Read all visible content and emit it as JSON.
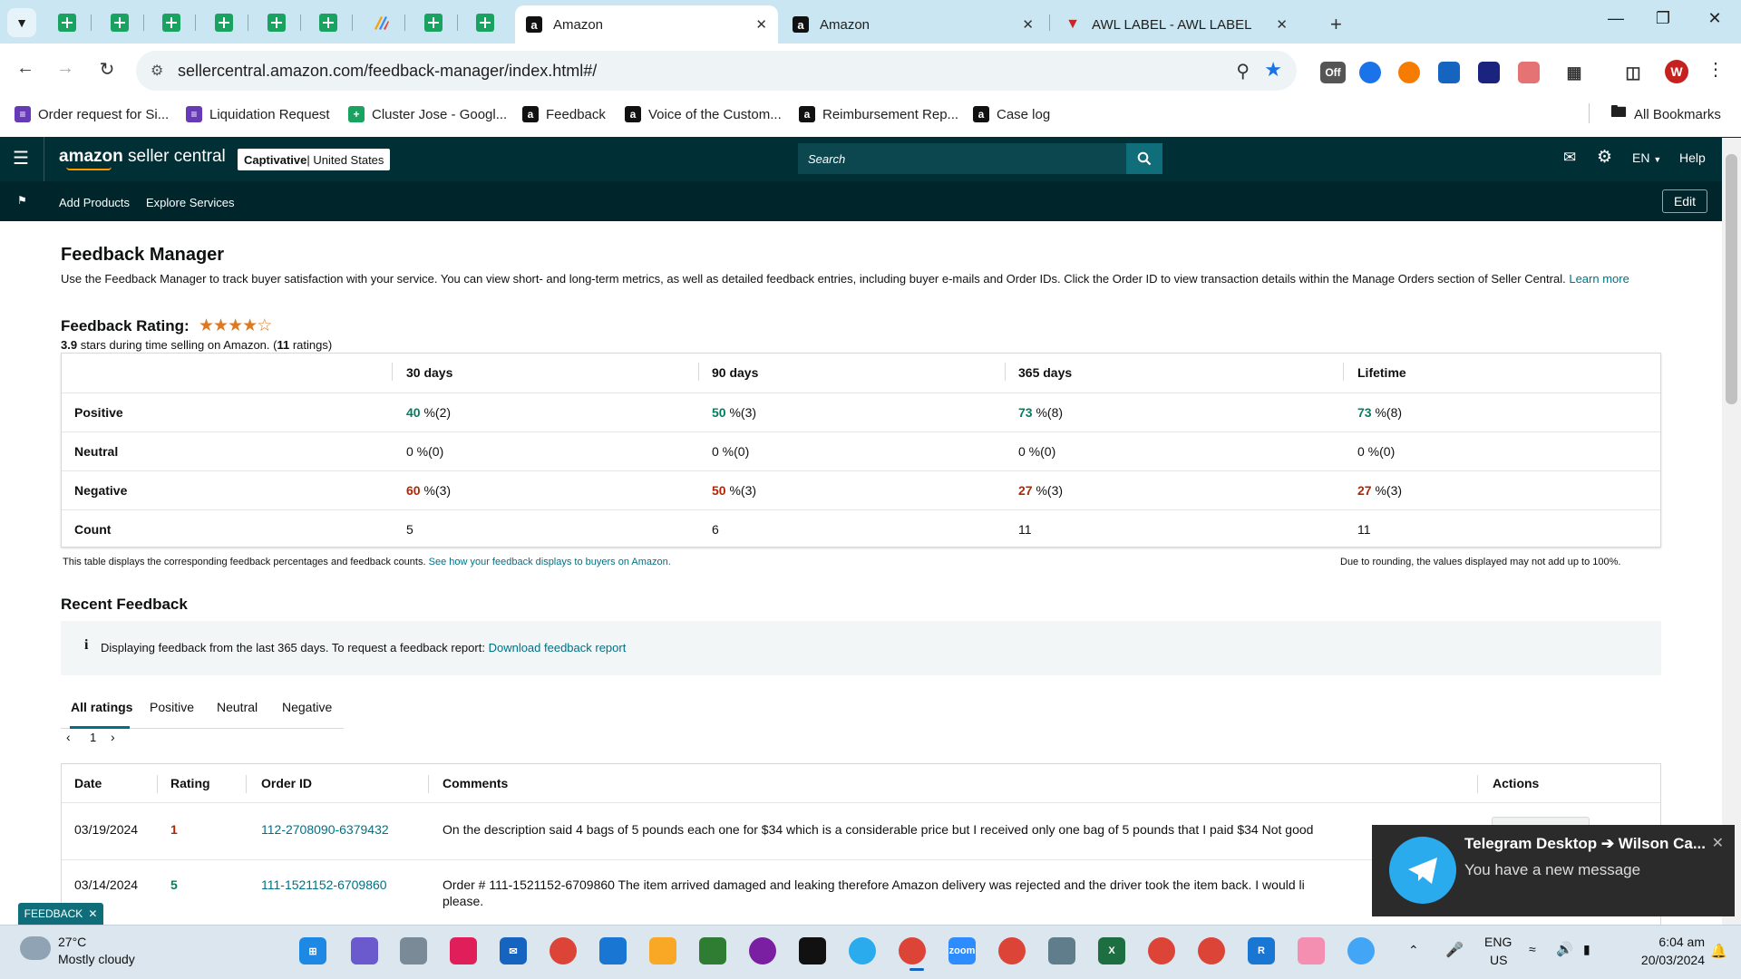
{
  "browser": {
    "tabs": [
      {
        "title": "Amazon",
        "active": true
      },
      {
        "title": "Amazon",
        "active": false
      },
      {
        "title": "AWL LABEL - AWL LABEL",
        "active": false
      }
    ],
    "url": "sellercentral.amazon.com/feedback-manager/index.html#/",
    "bookmarks": [
      {
        "label": "Order request for Si...",
        "icon": "form"
      },
      {
        "label": "Liquidation Request",
        "icon": "form"
      },
      {
        "label": "Cluster Jose - Googl...",
        "icon": "sheet"
      },
      {
        "label": "Feedback",
        "icon": "amz"
      },
      {
        "label": "Voice of the Custom...",
        "icon": "amz"
      },
      {
        "label": "Reimbursement Rep...",
        "icon": "amz"
      },
      {
        "label": "Case log",
        "icon": "amz"
      }
    ],
    "all_bookmarks": "All Bookmarks",
    "profile_initial": "W",
    "ext_off_label": "Off"
  },
  "sc": {
    "logo_bold": "amazon",
    "logo_rest": " seller central",
    "store_name": "Captivative",
    "store_region": " | United States",
    "search_placeholder": "Search",
    "lang": "EN",
    "help": "Help",
    "nav_add_products": "Add Products",
    "nav_explore": "Explore Services",
    "edit": "Edit"
  },
  "page": {
    "title": "Feedback Manager",
    "intro": "Use the Feedback Manager to track buyer satisfaction with your service. You can view short- and long-term metrics, as well as detailed feedback entries, including buyer e-mails and Order IDs. Click the Order ID to view transaction details within the Manage Orders section of Seller Central.",
    "learn_more": "Learn more",
    "rating_label": "Feedback Rating:",
    "rating_value": "3.9",
    "rating_stars_filled": 4,
    "rating_text_mid": " stars during time selling on Amazon. (",
    "rating_count": "11",
    "rating_text_end": " ratings)",
    "table_note": "This table displays the corresponding feedback percentages and feedback counts.",
    "table_note_link": "See how your feedback displays to buyers on Amazon.",
    "rounding_note": "Due to rounding, the values displayed may not add up to 100%.",
    "recent_title": "Recent Feedback",
    "info_text": "Displaying feedback from the last 365 days. To request a feedback report:",
    "info_link": "Download feedback report",
    "filter_tabs": [
      "All ratings",
      "Positive",
      "Neutral",
      "Negative"
    ],
    "page_number": "1"
  },
  "metrics": {
    "columns": [
      "30 days",
      "90 days",
      "365 days",
      "Lifetime"
    ],
    "rows": [
      {
        "label": "Positive",
        "kind": "pos",
        "cells": [
          {
            "v": "40",
            "r": " %(2)"
          },
          {
            "v": "50",
            "r": " %(3)"
          },
          {
            "v": "73",
            "r": " %(8)"
          },
          {
            "v": "73",
            "r": " %(8)"
          }
        ]
      },
      {
        "label": "Neutral",
        "kind": "plain",
        "cells": [
          {
            "v": "0",
            "r": " %(0)"
          },
          {
            "v": "0",
            "r": " %(0)"
          },
          {
            "v": "0",
            "r": " %(0)"
          },
          {
            "v": "0",
            "r": " %(0)"
          }
        ]
      },
      {
        "label": "Negative",
        "kind": "neg",
        "cells": [
          {
            "v": "60",
            "r": " %(3)"
          },
          {
            "v": "50",
            "r": " %(3)"
          },
          {
            "v": "27",
            "r": " %(3)"
          },
          {
            "v": "27",
            "r": " %(3)"
          }
        ]
      },
      {
        "label": "Count",
        "kind": "plain",
        "cells": [
          {
            "v": "5",
            "r": ""
          },
          {
            "v": "6",
            "r": ""
          },
          {
            "v": "11",
            "r": ""
          },
          {
            "v": "11",
            "r": ""
          }
        ]
      }
    ]
  },
  "feedback": {
    "headers": [
      "Date",
      "Rating",
      "Order ID",
      "Comments",
      "Actions"
    ],
    "rows": [
      {
        "date": "03/19/2024",
        "rating": "1",
        "order_id": "112-2708090-6379432",
        "comment": "On the description said 4 bags of 5 pounds each one for $34 which is a considerable price but I received only one bag of 5 pounds that I paid $34 Not good"
      },
      {
        "date": "03/14/2024",
        "rating": "5",
        "order_id": "111-1521152-6709860",
        "comment": "Order # 111-1521152-6709860 The item arrived damaged and leaking therefore Amazon delivery was rejected and the driver took the item back. I would li",
        "comment2": "please."
      }
    ]
  },
  "feedback_pill": "FEEDBACK",
  "toast": {
    "title": "Telegram Desktop ➔ Wilson Ca...",
    "body": "You have a new message"
  },
  "taskbar": {
    "weather_temp": "27°C",
    "weather_desc": "Mostly cloudy",
    "lang_top": "ENG",
    "lang_bottom": "US",
    "time": "6:04 am",
    "date": "20/03/2024"
  },
  "colors": {
    "sc_header": "#002f36",
    "positive": "#067d62",
    "negative": "#b12704",
    "link": "#007185"
  }
}
